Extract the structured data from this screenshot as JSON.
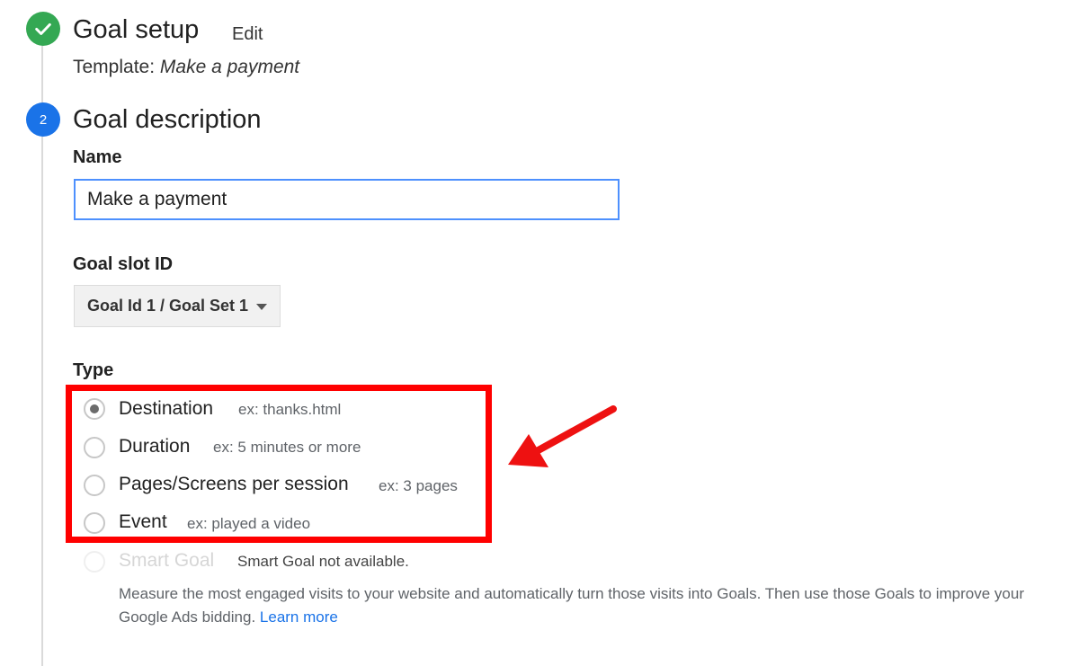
{
  "step1": {
    "title": "Goal setup",
    "edit_label": "Edit",
    "template_label": "Template:",
    "template_value": "Make a payment"
  },
  "step2": {
    "number": "2",
    "title": "Goal description"
  },
  "name_field": {
    "label": "Name",
    "value": "Make a payment"
  },
  "slot": {
    "label": "Goal slot ID",
    "selected": "Goal Id 1 / Goal Set 1"
  },
  "type": {
    "label": "Type",
    "options": [
      {
        "label": "Destination",
        "example": "ex: thanks.html",
        "checked": true
      },
      {
        "label": "Duration",
        "example": "ex: 5 minutes or more",
        "checked": false
      },
      {
        "label": "Pages/Screens per session",
        "example": "ex: 3 pages",
        "checked": false
      },
      {
        "label": "Event",
        "example": "ex: played a video",
        "checked": false
      }
    ],
    "smart_goal": {
      "label": "Smart Goal",
      "status": "Smart Goal not available."
    }
  },
  "description": {
    "text": "Measure the most engaged visits to your website and automatically turn those visits into Goals. Then use those Goals to improve your Google Ads bidding.",
    "link": "Learn more"
  },
  "annotation_color": "#ff0000"
}
